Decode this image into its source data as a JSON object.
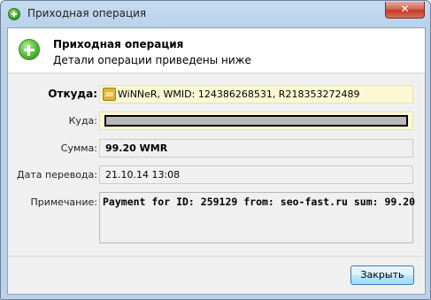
{
  "window": {
    "title": "Приходная операция",
    "close_glyph": "✕"
  },
  "header": {
    "title": "Приходная операция",
    "subtitle": "Детали операции приведены ниже"
  },
  "fields": {
    "from": {
      "label": "Откуда:",
      "value": "WiNNeR, WMID: 124386268531, R218353272489"
    },
    "to": {
      "label": "Куда:",
      "value": ""
    },
    "amount": {
      "label": "Сумма:",
      "value": "99.20 WMR"
    },
    "date": {
      "label": "Дата перевода:",
      "value": "21.10.14 13:08"
    },
    "note": {
      "label": "Примечание:",
      "value": "Payment for ID: 259129 from: seo-fast.ru sum: 99.20"
    }
  },
  "footer": {
    "close_label": "Закрыть"
  },
  "icons": {
    "title_icon": "green-plus-icon",
    "header_icon": "green-plus-icon",
    "wallet_icon": "wallet-icon"
  }
}
